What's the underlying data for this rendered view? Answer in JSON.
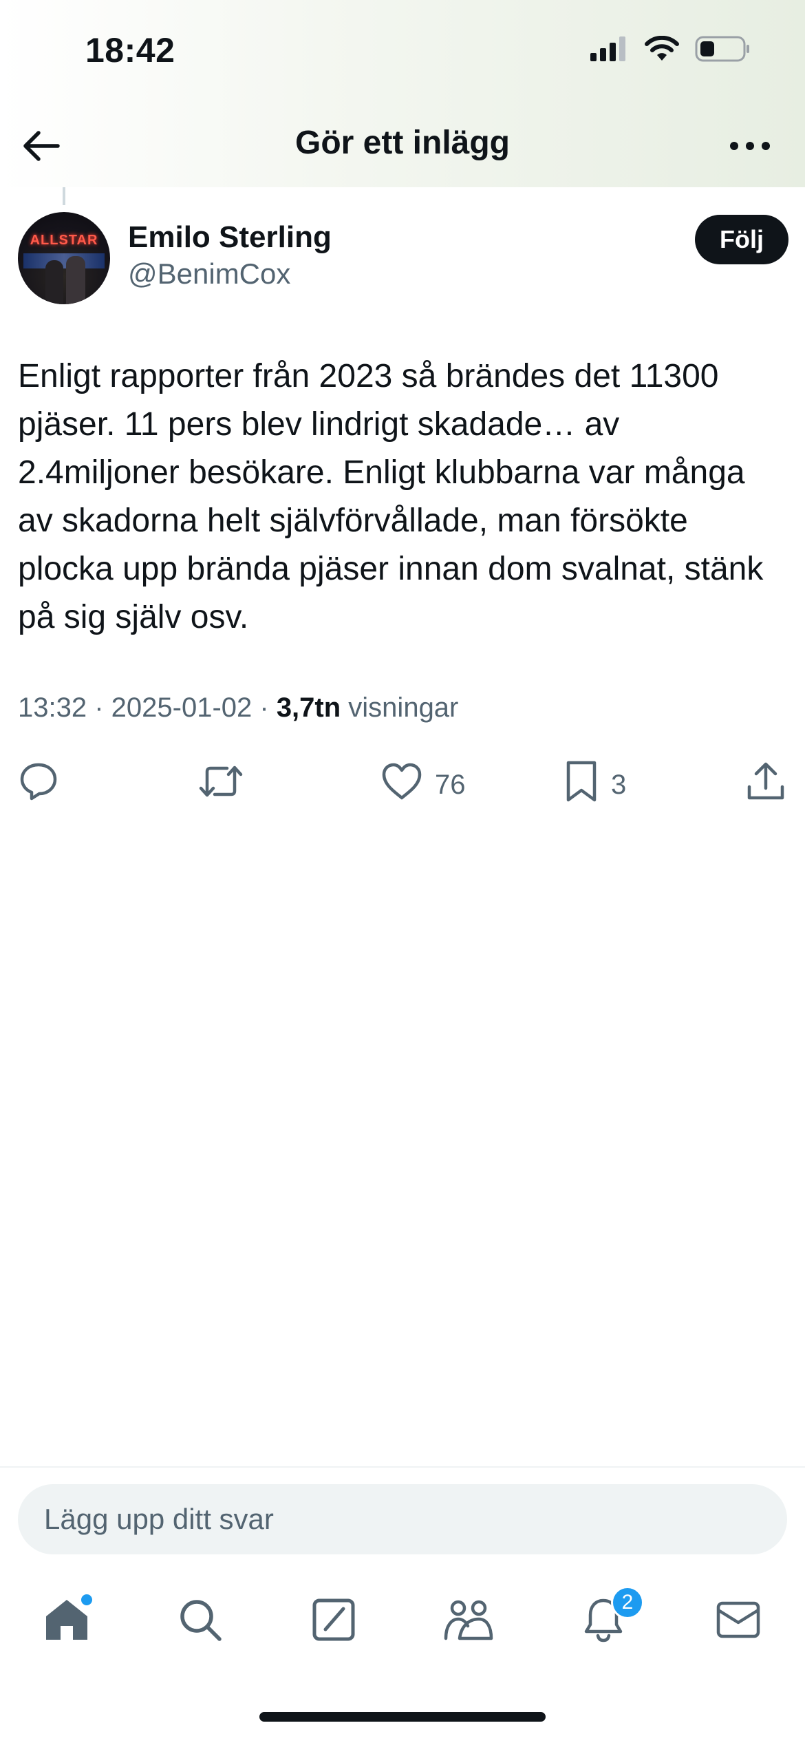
{
  "status_bar": {
    "time": "18:42",
    "icons": [
      "cellular-signal-icon",
      "wifi-icon",
      "battery-icon"
    ]
  },
  "nav": {
    "back_icon": "arrow-left-icon",
    "title": "Gör ett inlägg",
    "more_icon": "more-horizontal-icon"
  },
  "post": {
    "author_name": "Emilo Sterling",
    "author_handle": "@BenimCox",
    "avatar_sign": "ALLSTAR",
    "follow_label": "Följ",
    "text": "Enligt rapporter från 2023 så brändes det 11300 pjäser. 11 pers blev lindrigt skadade… av 2.4miljoner besökare. Enligt klubbarna var många av skadorna helt självförvållade, man försökte plocka upp brända pjäser innan dom svalnat, stänk på sig själv osv.",
    "time": "13:32",
    "separator": " · ",
    "date": "2025-01-02",
    "views_count": "3,7tn",
    "views_label": "visningar"
  },
  "actions": {
    "reply_icon": "reply-icon",
    "repost_icon": "repost-icon",
    "like_icon": "heart-icon",
    "like_count": "76",
    "bookmark_icon": "bookmark-icon",
    "bookmark_count": "3",
    "share_icon": "share-icon"
  },
  "reply_box": {
    "placeholder": "Lägg upp ditt svar"
  },
  "tab_bar": {
    "items": [
      "home-icon",
      "search-icon",
      "grok-icon",
      "communities-icon",
      "notifications-icon",
      "messages-icon"
    ],
    "notifications_badge": "2"
  },
  "colors": {
    "text_primary": "#0f1419",
    "text_secondary": "#536471",
    "accent": "#1d9bf0",
    "follow_bg": "#0f1419",
    "input_bg": "#eff3f4"
  }
}
